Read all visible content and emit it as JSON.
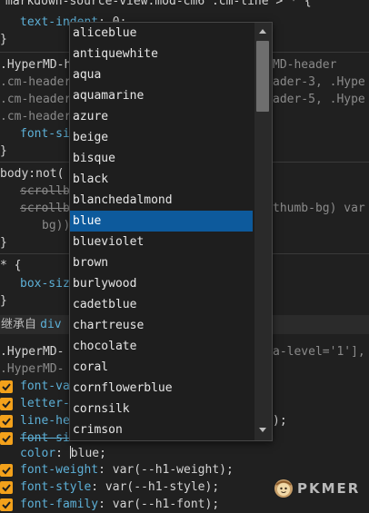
{
  "editor": {
    "l0": "markdown-source-view.mod-cm6 .cm-line > * {",
    "l1_prop": "text-indent",
    "l1_val": ": 0;",
    "l2": "}",
    "l3": ".HyperMD-header",
    "l3_right": "MD-header",
    "l4": ".cm-header",
    "l4_right": "ader-3, .Hype",
    "l5": ".cm-header",
    "l5_right": "ader-5, .Hype",
    "l6": ".cm-header",
    "l7_prop": "font-si",
    "l8": "}",
    "l9": "body:not(",
    "l10": "scrollb",
    "l11": "scrollb",
    "l11_right": "thumb-bg) var",
    "l12": "bg));",
    "l13": "}",
    "l14": "* {",
    "l15_prop": "box-siz",
    "l16": "}",
    "inherit_label": "继承自",
    "inherit_sel": "div",
    "l18": ".HyperMD-",
    "l18_right": "a-level='1'],",
    "l19": ".HyperMD-",
    "l20_prop": "font-va",
    "l21_prop": "letter-",
    "l22_prop": "line-he",
    "l22_right": ");",
    "l23_prop": "font-si",
    "l24_prop": "color",
    "l24_val": "blue;",
    "l25_prop": "font-weight",
    "l25_val": ": var(--h1-weight);",
    "l26_prop": "font-style",
    "l26_val": ": var(--h1-style);",
    "l27_prop": "font-family",
    "l27_val": ": var(--h1-font);"
  },
  "dropdown": {
    "items": [
      "aliceblue",
      "antiquewhite",
      "aqua",
      "aquamarine",
      "azure",
      "beige",
      "bisque",
      "black",
      "blanchedalmond",
      "blue",
      "blueviolet",
      "brown",
      "burlywood",
      "cadetblue",
      "chartreuse",
      "chocolate",
      "coral",
      "cornflowerblue",
      "cornsilk",
      "crimson"
    ],
    "selected_index": 9
  },
  "logo": {
    "text": "PKMER"
  },
  "colors": {
    "accent": "#0d5a9c",
    "checkbox": "#f3a11b",
    "property": "#5db0d7"
  }
}
